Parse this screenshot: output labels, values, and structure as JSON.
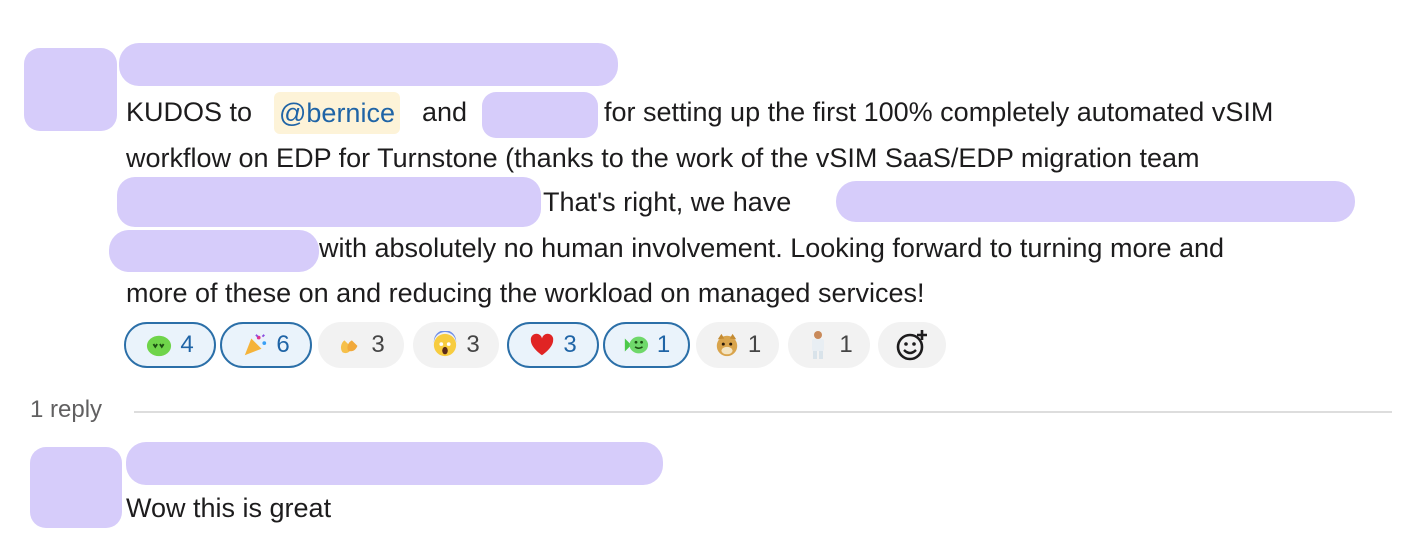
{
  "message": {
    "mention": "@bernice",
    "line1_a": "KUDOS to",
    "line1_b": "and",
    "line1_c": "for setting up the first 100% completely automated vSIM",
    "line2": "workflow on EDP for Turnstone (thanks to the work of the vSIM SaaS/EDP migration team",
    "line3": "That's right, we have",
    "line4": "with absolutely no human involvement. Looking forward to turning more and",
    "line5": "more of these on and reducing the workload on managed services!"
  },
  "reactions": [
    {
      "emoji": "green-blob-emoji",
      "count": "4",
      "active": true
    },
    {
      "emoji": "party-popper-emoji",
      "count": "6",
      "active": true
    },
    {
      "emoji": "clapping-hands-emoji",
      "count": "3",
      "active": false
    },
    {
      "emoji": "screaming-face-emoji",
      "count": "3",
      "active": false
    },
    {
      "emoji": "red-heart-emoji",
      "count": "3",
      "active": true
    },
    {
      "emoji": "green-fish-emoji",
      "count": "1",
      "active": true
    },
    {
      "emoji": "doge-emoji",
      "count": "1",
      "active": false
    },
    {
      "emoji": "person-in-suit-emoji",
      "count": "1",
      "active": false
    }
  ],
  "add_reaction_icon": "add-reaction-icon",
  "thread": {
    "reply_count": "1 reply"
  },
  "reply": {
    "text": "Wow this is great"
  },
  "colors": {
    "redaction": "#d6ccfa",
    "mention_bg": "#fdf3d8",
    "mention_text": "#1f64a6",
    "active_border": "#2b6fa8"
  }
}
